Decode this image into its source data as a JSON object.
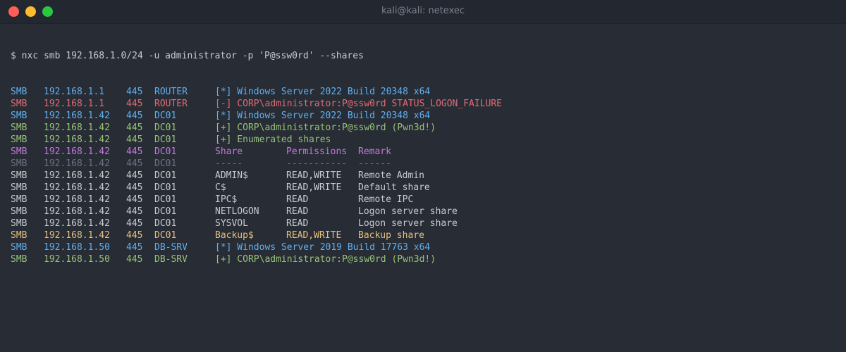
{
  "window": {
    "title": "kali@kali: netexec"
  },
  "colors": {
    "blue": "#61afef",
    "red": "#e06c75",
    "green": "#98c379",
    "magenta": "#c678dd",
    "grey": "#6b7280",
    "white": "#c7cbd1",
    "yellow": "#e5c07b"
  },
  "terminal": {
    "command": "$ nxc smb 192.168.1.0/24 -u administrator -p 'P@ssw0rd' --shares",
    "lines": [
      {
        "proto": "SMB",
        "ip": "192.168.1.1",
        "port": "445",
        "host": "ROUTER",
        "msg": "[*] Windows Server 2022 Build 20348 x64",
        "color": "blue"
      },
      {
        "proto": "SMB",
        "ip": "192.168.1.1",
        "port": "445",
        "host": "ROUTER",
        "msg": "[-] CORP\\administrator:P@ssw0rd STATUS_LOGON_FAILURE",
        "color": "red"
      },
      {
        "proto": "SMB",
        "ip": "192.168.1.42",
        "port": "445",
        "host": "DC01",
        "msg": "[*] Windows Server 2022 Build 20348 x64",
        "color": "blue"
      },
      {
        "proto": "SMB",
        "ip": "192.168.1.42",
        "port": "445",
        "host": "DC01",
        "msg": "[+] CORP\\administrator:P@ssw0rd (Pwn3d!)",
        "color": "green"
      },
      {
        "proto": "SMB",
        "ip": "192.168.1.42",
        "port": "445",
        "host": "DC01",
        "msg": "[+] Enumerated shares",
        "color": "green"
      },
      {
        "proto": "SMB",
        "ip": "192.168.1.42",
        "port": "445",
        "host": "DC01",
        "share": "Share",
        "perm": "Permissions",
        "remark": "Remark",
        "color": "magenta"
      },
      {
        "proto": "SMB",
        "ip": "192.168.1.42",
        "port": "445",
        "host": "DC01",
        "share": "-----",
        "perm": "-----------",
        "remark": "------",
        "color": "grey"
      },
      {
        "proto": "SMB",
        "ip": "192.168.1.42",
        "port": "445",
        "host": "DC01",
        "share": "ADMIN$",
        "perm": "READ,WRITE",
        "remark": "Remote Admin",
        "color": "white"
      },
      {
        "proto": "SMB",
        "ip": "192.168.1.42",
        "port": "445",
        "host": "DC01",
        "share": "C$",
        "perm": "READ,WRITE",
        "remark": "Default share",
        "color": "white"
      },
      {
        "proto": "SMB",
        "ip": "192.168.1.42",
        "port": "445",
        "host": "DC01",
        "share": "IPC$",
        "perm": "READ",
        "remark": "Remote IPC",
        "color": "white"
      },
      {
        "proto": "SMB",
        "ip": "192.168.1.42",
        "port": "445",
        "host": "DC01",
        "share": "NETLOGON",
        "perm": "READ",
        "remark": "Logon server share",
        "color": "white"
      },
      {
        "proto": "SMB",
        "ip": "192.168.1.42",
        "port": "445",
        "host": "DC01",
        "share": "SYSVOL",
        "perm": "READ",
        "remark": "Logon server share",
        "color": "white"
      },
      {
        "proto": "SMB",
        "ip": "192.168.1.42",
        "port": "445",
        "host": "DC01",
        "share": "Backup$",
        "perm": "READ,WRITE",
        "remark": "Backup share",
        "color": "yellow"
      },
      {
        "proto": "SMB",
        "ip": "192.168.1.50",
        "port": "445",
        "host": "DB-SRV",
        "msg": "[*] Windows Server 2019 Build 17763 x64",
        "color": "blue"
      },
      {
        "proto": "SMB",
        "ip": "192.168.1.50",
        "port": "445",
        "host": "DB-SRV",
        "msg": "[+] CORP\\administrator:P@ssw0rd (Pwn3d!)",
        "color": "green"
      }
    ]
  }
}
